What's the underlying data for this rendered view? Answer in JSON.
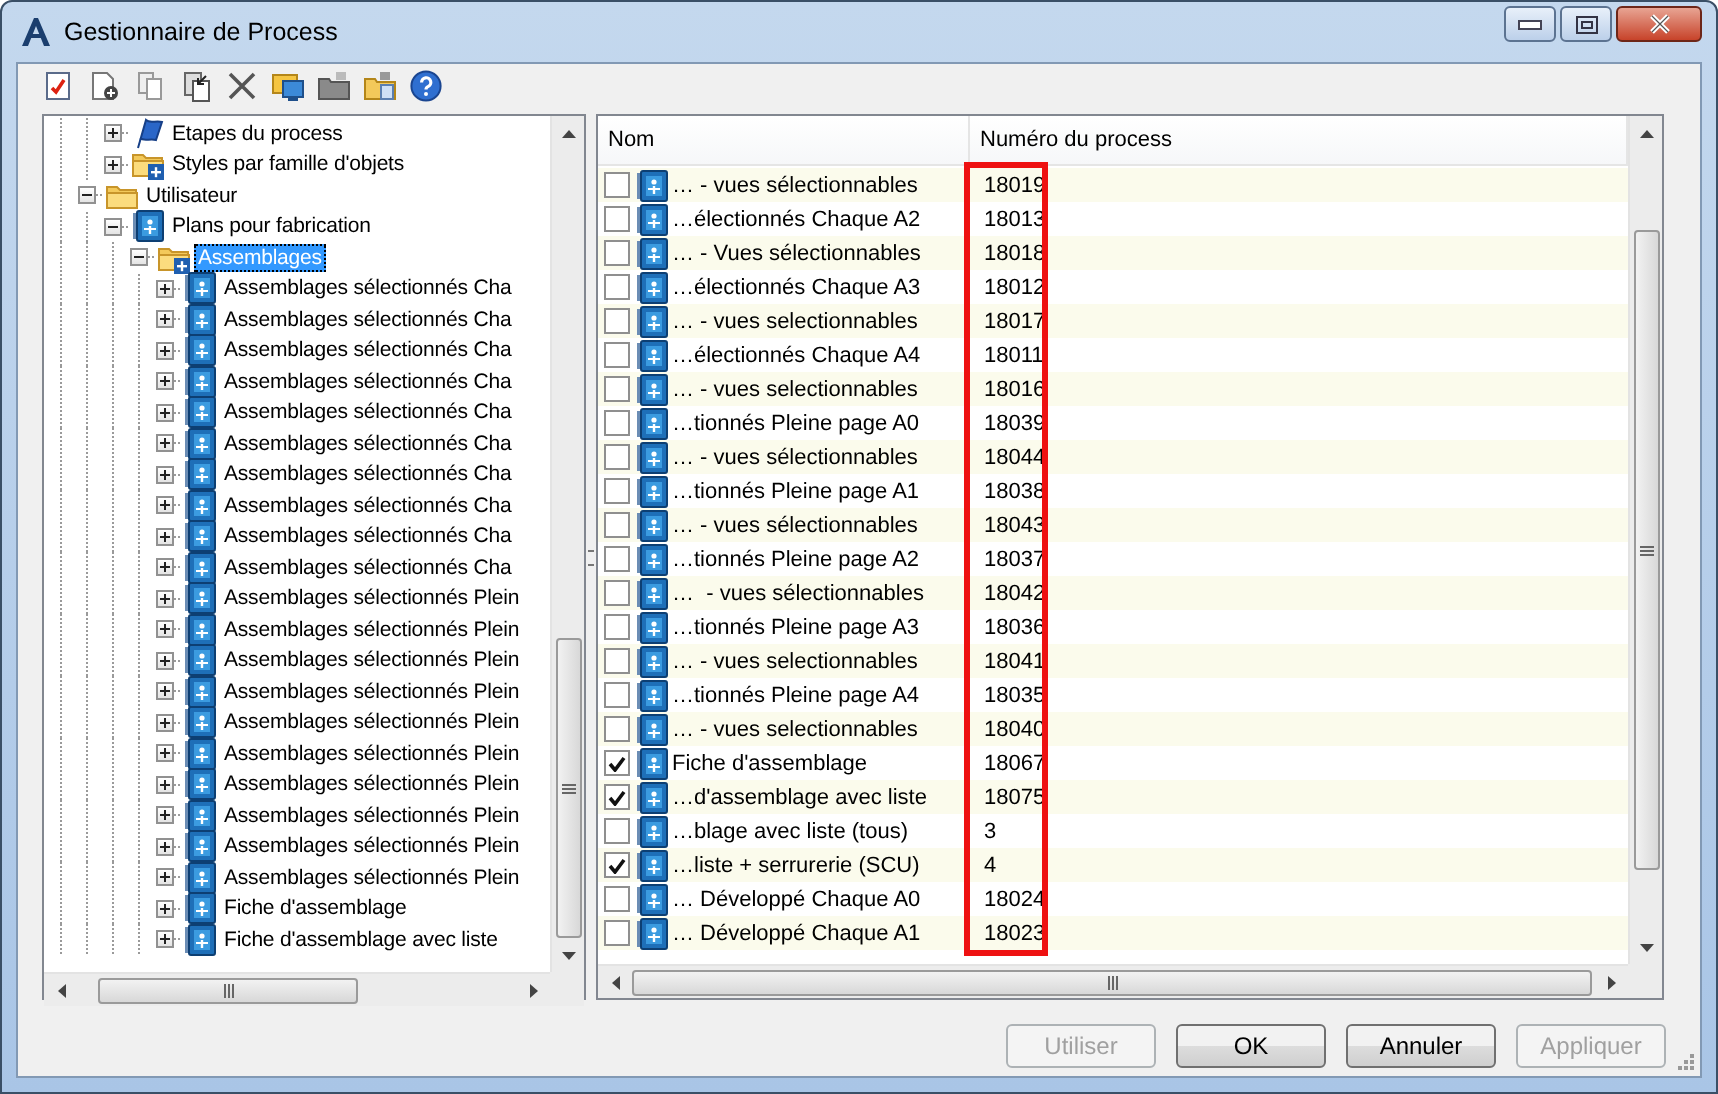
{
  "window": {
    "title": "Gestionnaire de Process"
  },
  "tree": {
    "partial_branch": [
      {
        "label": "Etapes du process",
        "kind": "flag",
        "expanded": false,
        "selected": false
      },
      {
        "label": "Styles par famille d'objets",
        "kind": "style-folder",
        "expanded": false,
        "selected": false
      }
    ],
    "items": [
      {
        "label": "Utilisateur",
        "kind": "folder",
        "expanded": true,
        "selected": false,
        "children": [
          {
            "label": "Plans pour fabrication",
            "kind": "process",
            "expanded": true,
            "selected": false,
            "children": [
              {
                "label": "Assemblages",
                "kind": "style-folder",
                "expanded": true,
                "selected": true,
                "children": [
                  {
                    "label": "Assemblages sélectionnés Cha",
                    "kind": "process",
                    "expanded": false,
                    "selected": false
                  },
                  {
                    "label": "Assemblages sélectionnés Cha",
                    "kind": "process",
                    "expanded": false,
                    "selected": false
                  },
                  {
                    "label": "Assemblages sélectionnés Cha",
                    "kind": "process",
                    "expanded": false,
                    "selected": false
                  },
                  {
                    "label": "Assemblages sélectionnés Cha",
                    "kind": "process",
                    "expanded": false,
                    "selected": false
                  },
                  {
                    "label": "Assemblages sélectionnés Cha",
                    "kind": "process",
                    "expanded": false,
                    "selected": false
                  },
                  {
                    "label": "Assemblages sélectionnés Cha",
                    "kind": "process",
                    "expanded": false,
                    "selected": false
                  },
                  {
                    "label": "Assemblages sélectionnés Cha",
                    "kind": "process",
                    "expanded": false,
                    "selected": false
                  },
                  {
                    "label": "Assemblages sélectionnés Cha",
                    "kind": "process",
                    "expanded": false,
                    "selected": false
                  },
                  {
                    "label": "Assemblages sélectionnés Cha",
                    "kind": "process",
                    "expanded": false,
                    "selected": false
                  },
                  {
                    "label": "Assemblages sélectionnés Cha",
                    "kind": "process",
                    "expanded": false,
                    "selected": false
                  },
                  {
                    "label": "Assemblages sélectionnés Plein",
                    "kind": "process",
                    "expanded": false,
                    "selected": false
                  },
                  {
                    "label": "Assemblages sélectionnés Plein",
                    "kind": "process",
                    "expanded": false,
                    "selected": false
                  },
                  {
                    "label": "Assemblages sélectionnés Plein",
                    "kind": "process",
                    "expanded": false,
                    "selected": false
                  },
                  {
                    "label": "Assemblages sélectionnés Plein",
                    "kind": "process",
                    "expanded": false,
                    "selected": false
                  },
                  {
                    "label": "Assemblages sélectionnés Plein",
                    "kind": "process",
                    "expanded": false,
                    "selected": false
                  },
                  {
                    "label": "Assemblages sélectionnés Plein",
                    "kind": "process",
                    "expanded": false,
                    "selected": false
                  },
                  {
                    "label": "Assemblages sélectionnés Plein",
                    "kind": "process",
                    "expanded": false,
                    "selected": false
                  },
                  {
                    "label": "Assemblages sélectionnés Plein",
                    "kind": "process",
                    "expanded": false,
                    "selected": false
                  },
                  {
                    "label": "Assemblages sélectionnés Plein",
                    "kind": "process",
                    "expanded": false,
                    "selected": false
                  },
                  {
                    "label": "Assemblages sélectionnés Plein",
                    "kind": "process",
                    "expanded": false,
                    "selected": false
                  },
                  {
                    "label": "Fiche d'assemblage",
                    "kind": "process",
                    "expanded": false,
                    "selected": false
                  },
                  {
                    "label": "Fiche d'assemblage avec liste",
                    "kind": "process",
                    "expanded": false,
                    "selected": false
                  }
                ]
              }
            ]
          }
        ]
      }
    ]
  },
  "table": {
    "columns": [
      "Nom",
      "Numéro du process"
    ],
    "rows": [
      {
        "checked": false,
        "name": "… - vues sélectionnables",
        "number": "18019"
      },
      {
        "checked": false,
        "name": "…électionnés Chaque A2",
        "number": "18013"
      },
      {
        "checked": false,
        "name": "… - Vues sélectionnables",
        "number": "18018"
      },
      {
        "checked": false,
        "name": "…électionnés Chaque A3",
        "number": "18012"
      },
      {
        "checked": false,
        "name": "… - vues selectionnables",
        "number": "18017"
      },
      {
        "checked": false,
        "name": "…électionnés Chaque A4",
        "number": "18011"
      },
      {
        "checked": false,
        "name": "… - vues selectionnables",
        "number": "18016"
      },
      {
        "checked": false,
        "name": "…tionnés Pleine page A0",
        "number": "18039"
      },
      {
        "checked": false,
        "name": "… - vues sélectionnables",
        "number": "18044"
      },
      {
        "checked": false,
        "name": "…tionnés Pleine page A1",
        "number": "18038"
      },
      {
        "checked": false,
        "name": "… - vues sélectionnables",
        "number": "18043"
      },
      {
        "checked": false,
        "name": "…tionnés Pleine page A2",
        "number": "18037"
      },
      {
        "checked": false,
        "name": "…  - vues sélectionnables",
        "number": "18042"
      },
      {
        "checked": false,
        "name": "…tionnés Pleine page A3",
        "number": "18036"
      },
      {
        "checked": false,
        "name": "… - vues selectionnables",
        "number": "18041"
      },
      {
        "checked": false,
        "name": "…tionnés Pleine page A4",
        "number": "18035"
      },
      {
        "checked": false,
        "name": "… - vues selectionnables",
        "number": "18040"
      },
      {
        "checked": true,
        "name": "Fiche d'assemblage",
        "number": "18067"
      },
      {
        "checked": true,
        "name": "…d'assemblage avec liste",
        "number": "18075"
      },
      {
        "checked": false,
        "name": "…blage avec liste (tous)",
        "number": "3"
      },
      {
        "checked": true,
        "name": "…liste + serrurerie (SCU)",
        "number": "4"
      },
      {
        "checked": false,
        "name": "… Développé Chaque A0",
        "number": "18024"
      },
      {
        "checked": false,
        "name": "… Développé Chaque A1",
        "number": "18023"
      }
    ]
  },
  "buttons": [
    {
      "label": "Utiliser",
      "disabled": true
    },
    {
      "label": "OK",
      "disabled": false
    },
    {
      "label": "Annuler",
      "disabled": false
    },
    {
      "label": "Appliquer",
      "disabled": true
    }
  ]
}
